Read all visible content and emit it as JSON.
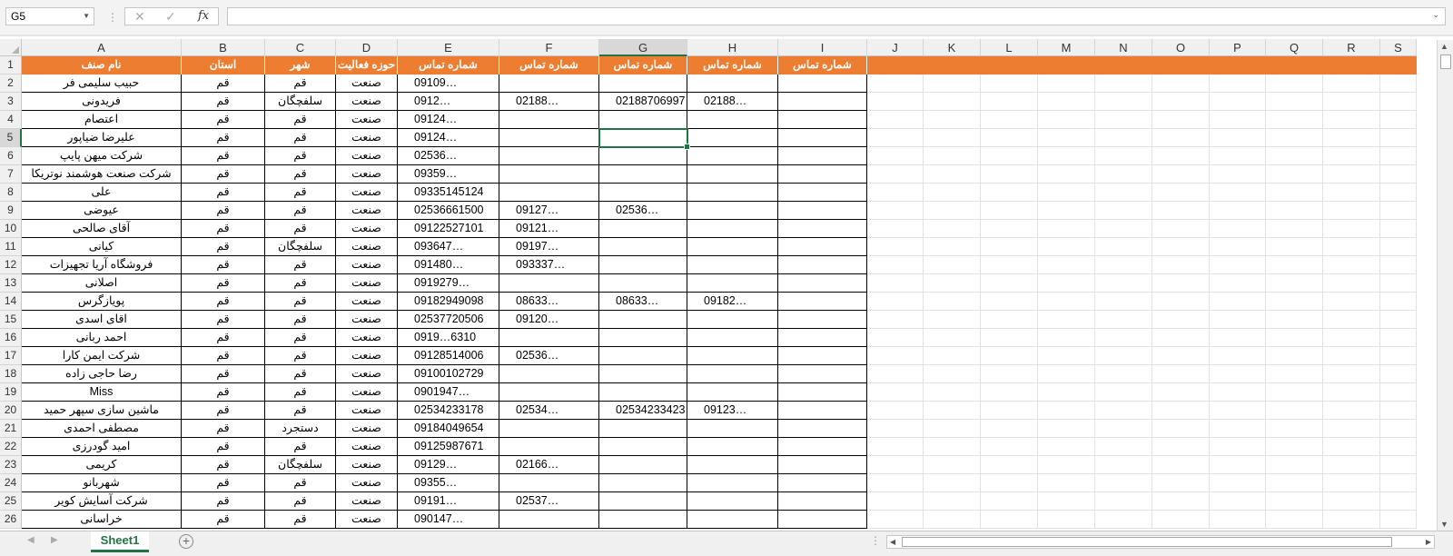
{
  "formula_bar": {
    "name_box": "G5",
    "fx": "fx",
    "content": ""
  },
  "columns": [
    "A",
    "B",
    "C",
    "D",
    "E",
    "F",
    "G",
    "H",
    "I",
    "J",
    "K",
    "L",
    "M",
    "N",
    "O",
    "P",
    "Q",
    "R",
    "S"
  ],
  "headers": [
    "نام صنف",
    "استان",
    "شهر",
    "حوزه فعالیت",
    "شماره تماس",
    "شماره تماس",
    "شماره تماس",
    "شماره تماس",
    "شماره تماس"
  ],
  "rows": [
    {
      "n": "2",
      "cells": [
        "حبیب سلیمی فر",
        "قم",
        "قم",
        "صنعت",
        "09109…",
        "",
        "",
        "",
        ""
      ]
    },
    {
      "n": "3",
      "cells": [
        "فریدونی",
        "قم",
        "سلفچگان",
        "صنعت",
        "0912…",
        "02188…",
        "02188706997",
        "02188…",
        ""
      ]
    },
    {
      "n": "4",
      "cells": [
        "اعتصام",
        "قم",
        "قم",
        "صنعت",
        "09124…",
        "",
        "",
        "",
        ""
      ]
    },
    {
      "n": "5",
      "cells": [
        "علیرضا ضیاپور",
        "قم",
        "قم",
        "صنعت",
        "09124…",
        "",
        "",
        "",
        ""
      ]
    },
    {
      "n": "6",
      "cells": [
        "شرکت میهن پایپ",
        "قم",
        "قم",
        "صنعت",
        "02536…",
        "",
        "",
        "",
        ""
      ]
    },
    {
      "n": "7",
      "cells": [
        "شرکت صنعت هوشمند نوتریکا",
        "قم",
        "قم",
        "صنعت",
        "09359…",
        "",
        "",
        "",
        ""
      ]
    },
    {
      "n": "8",
      "cells": [
        "علی",
        "قم",
        "قم",
        "صنعت",
        "09335145124",
        "",
        "",
        "",
        ""
      ]
    },
    {
      "n": "9",
      "cells": [
        "عیوضی",
        "قم",
        "قم",
        "صنعت",
        "02536661500",
        "09127…",
        "02536…",
        "",
        ""
      ]
    },
    {
      "n": "10",
      "cells": [
        "آقای صالحی",
        "قم",
        "قم",
        "صنعت",
        "09122527101",
        "09121…",
        "",
        "",
        ""
      ]
    },
    {
      "n": "11",
      "cells": [
        "کیانی",
        "قم",
        "سلفچگان",
        "صنعت",
        "093647…",
        "09197…",
        "",
        "",
        ""
      ]
    },
    {
      "n": "12",
      "cells": [
        "فروشگاه آریا تجهیزات",
        "قم",
        "قم",
        "صنعت",
        "091480…",
        "093337…",
        "",
        "",
        ""
      ]
    },
    {
      "n": "13",
      "cells": [
        "اصلانی",
        "قم",
        "قم",
        "صنعت",
        "0919279…",
        "",
        "",
        "",
        ""
      ]
    },
    {
      "n": "14",
      "cells": [
        "پویاز‌گرس",
        "قم",
        "قم",
        "صنعت",
        "09182949098",
        "08633…",
        "08633…",
        "09182…",
        ""
      ]
    },
    {
      "n": "15",
      "cells": [
        "اقای اسدی",
        "قم",
        "قم",
        "صنعت",
        "02537720506",
        "09120…",
        "",
        "",
        ""
      ]
    },
    {
      "n": "16",
      "cells": [
        "احمد ربانی",
        "قم",
        "قم",
        "صنعت",
        "0919…6310",
        "",
        "",
        "",
        ""
      ]
    },
    {
      "n": "17",
      "cells": [
        "شرکت ایمن کارا",
        "قم",
        "قم",
        "صنعت",
        "09128514006",
        "02536…",
        "",
        "",
        ""
      ]
    },
    {
      "n": "18",
      "cells": [
        "رضا حاجی زاده",
        "قم",
        "قم",
        "صنعت",
        "09100102729",
        "",
        "",
        "",
        ""
      ]
    },
    {
      "n": "19",
      "cells": [
        "Miss",
        "قم",
        "قم",
        "صنعت",
        "0901947…",
        "",
        "",
        "",
        ""
      ]
    },
    {
      "n": "20",
      "cells": [
        "ماشین سازی سپهر حمید",
        "قم",
        "قم",
        "صنعت",
        "02534233178",
        "02534…",
        "02534233423",
        "09123…",
        ""
      ]
    },
    {
      "n": "21",
      "cells": [
        "مصطفی احمدی",
        "قم",
        "دستجرد",
        "صنعت",
        "09184049654",
        "",
        "",
        "",
        ""
      ]
    },
    {
      "n": "22",
      "cells": [
        "امید گودرزی",
        "قم",
        "قم",
        "صنعت",
        "09125987671",
        "",
        "",
        "",
        ""
      ]
    },
    {
      "n": "23",
      "cells": [
        "کریمی",
        "قم",
        "سلفچگان",
        "صنعت",
        "09129…",
        "02166…",
        "",
        "",
        ""
      ]
    },
    {
      "n": "24",
      "cells": [
        "شهربانو",
        "قم",
        "قم",
        "صنعت",
        "09355…",
        "",
        "",
        "",
        ""
      ]
    },
    {
      "n": "25",
      "cells": [
        "شرکت آسایش کویر",
        "قم",
        "قم",
        "صنعت",
        "09191…",
        "02537…",
        "",
        "",
        ""
      ]
    },
    {
      "n": "26",
      "cells": [
        "خراسانی",
        "قم",
        "قم",
        "صنعت",
        "090147…",
        "",
        "",
        "",
        ""
      ]
    }
  ],
  "sheet_tab": "Sheet1",
  "icons": {
    "add_sheet": "plus-circle-icon",
    "cancel": "x-icon",
    "enter": "check-icon"
  },
  "colors": {
    "header_fill": "#ed7d31",
    "selection": "#217346"
  }
}
